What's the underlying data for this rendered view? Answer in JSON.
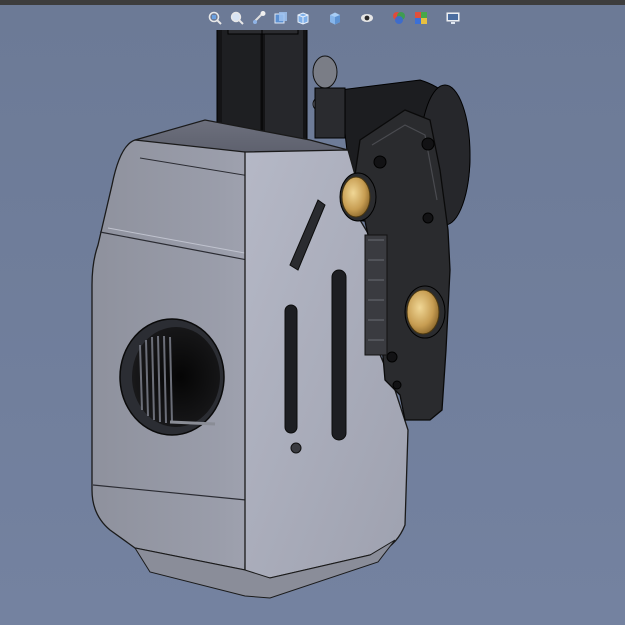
{
  "app": {
    "window": "cad-3d-viewport"
  },
  "colors": {
    "background": "#6f7d99",
    "body_plastic": "#9a9daa",
    "body_dark": "#5e6170",
    "brass": "#c8a25a",
    "black_part": "#1f2022"
  },
  "toolbar": {
    "icons": [
      {
        "name": "zoom-to-fit-icon"
      },
      {
        "name": "zoom-area-icon"
      },
      {
        "name": "previous-view-icon"
      },
      {
        "name": "section-view-icon"
      },
      {
        "name": "view-orientation-icon"
      },
      {
        "name": "display-style-icon"
      },
      {
        "name": "hide-show-items-icon"
      },
      {
        "name": "edit-appearance-icon"
      },
      {
        "name": "apply-scene-icon"
      },
      {
        "name": "view-settings-icon"
      }
    ]
  }
}
